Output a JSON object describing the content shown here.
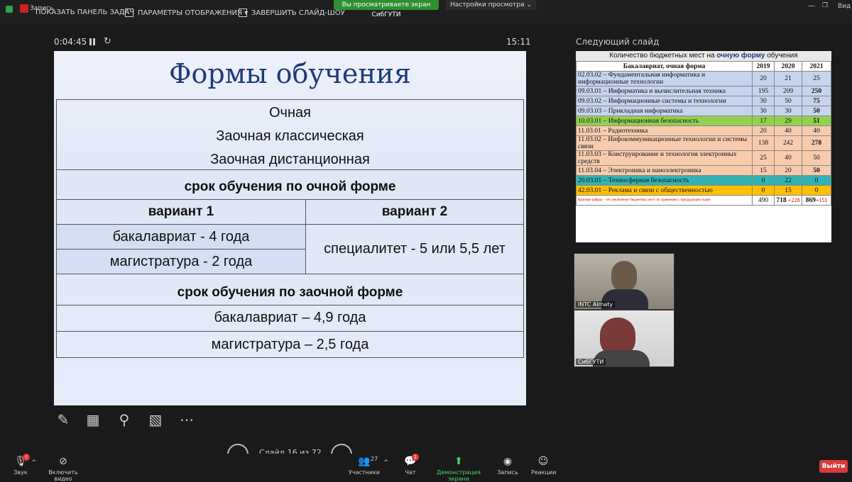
{
  "topbar": {
    "rec_label": "Запись",
    "taskbar_label": "ПОКАЗАТЬ ПАНЕЛЬ ЗАДАЧ",
    "display_label": "ПАРАМЕТРЫ ОТОБРАЖЕНИЯ ▾",
    "end_show_label": "ЗАВЕРШИТЬ СЛАЙД-ШОУ",
    "share_banner": "Вы просматриваете экран СибГУТИ",
    "view_settings": "Настройки просмотра ⌄",
    "view_label": "Вид"
  },
  "presenter": {
    "timer": "0:04:45",
    "clock": "15:11",
    "slide_counter": "Слайд 16 из 72"
  },
  "slide": {
    "title": "Формы обучения",
    "forms": [
      "Очная",
      "Заочная классическая",
      "Заочная дистанционная"
    ],
    "fulltime_header": "срок обучения по очной форме",
    "variant1": "вариант 1",
    "variant2": "вариант 2",
    "bachelor": "бакалавриат - 4 года",
    "master": "магистратура - 2 года",
    "specialist": "специалитет - 5 или 5,5 лет",
    "parttime_header": "срок обучения по заочной форме",
    "pt_bachelor": "бакалавриат – 4,9 года",
    "pt_master": "магистратура – 2,5 года"
  },
  "next": {
    "label": "Следующий слайд",
    "caption_pre": "Количество бюджетных мест на ",
    "caption_bold": "очную форму",
    "caption_post": " обучения",
    "col_head": "Бакалавриат, очная форма",
    "years": [
      "2019",
      "2020",
      "2021"
    ],
    "rows": [
      {
        "name": "02.03.02 – Фундаментальная информатика и информационные технологии",
        "v": [
          "20",
          "21",
          "25"
        ],
        "bold": false,
        "color": "#c6d4ee"
      },
      {
        "name": "09.03.01 – Информатика и вычислительная техника",
        "v": [
          "195",
          "209",
          "250"
        ],
        "bold": true,
        "color": "#c6d4ee"
      },
      {
        "name": "09.03.02 – Информационные системы и технологии",
        "v": [
          "30",
          "50",
          "75"
        ],
        "bold": true,
        "color": "#c6d4ee"
      },
      {
        "name": "09.03.03 – Прикладная информатика",
        "v": [
          "30",
          "30",
          "50"
        ],
        "bold": true,
        "color": "#c6d4ee"
      },
      {
        "name": "10.03.01 – Информационная безопасность",
        "v": [
          "17",
          "29",
          "51"
        ],
        "bold": true,
        "color": "#92d050"
      },
      {
        "name": "11.03.01 – Радиотехника",
        "v": [
          "20",
          "40",
          "40"
        ],
        "bold": false,
        "color": "#f8cbad"
      },
      {
        "name": "11.03.02 – Инфокоммуникационные технологии и системы связи",
        "v": [
          "138",
          "242",
          "278"
        ],
        "bold": true,
        "color": "#f8cbad"
      },
      {
        "name": "11.03.03 – Конструирование и технология электронных средств",
        "v": [
          "25",
          "40",
          "50"
        ],
        "bold": false,
        "color": "#f8cbad"
      },
      {
        "name": "11.03.04 – Электроника и наноэлектроника",
        "v": [
          "15",
          "20",
          "50"
        ],
        "bold": true,
        "color": "#f8cbad"
      },
      {
        "name": "20.03.01 – Техносферная безопасность",
        "v": [
          "0",
          "22",
          "0"
        ],
        "bold": false,
        "color": "#33b3b3"
      },
      {
        "name": "42.03.01 – Реклама и связи с общественностью",
        "v": [
          "0",
          "15",
          "0"
        ],
        "bold": false,
        "color": "#ffc000"
      }
    ],
    "footnote": "Красные цифры – это увеличение бюджетных мест по сравнению с предыдущим годом",
    "total_2019": "490",
    "total_2020": "718",
    "inc_2020": "+228",
    "total_2021": "869",
    "inc_2021": "+151"
  },
  "videos": [
    {
      "name": "INTC Almaty"
    },
    {
      "name": "СибГУТИ"
    }
  ],
  "bottom": {
    "sound": "Звук",
    "video": "Включить видео",
    "participants": "Участники",
    "participants_count": "27",
    "chat": "Чат",
    "chat_badge": "1",
    "sound_badge": "!",
    "share": "Демонстрация экрана",
    "record": "Запись",
    "reactions": "Реакции",
    "leave": "Выйти"
  },
  "colors": {
    "accent_green": "#2f8f2f",
    "leave_red": "#d83b3b",
    "slide_title": "#1f3a7a"
  }
}
